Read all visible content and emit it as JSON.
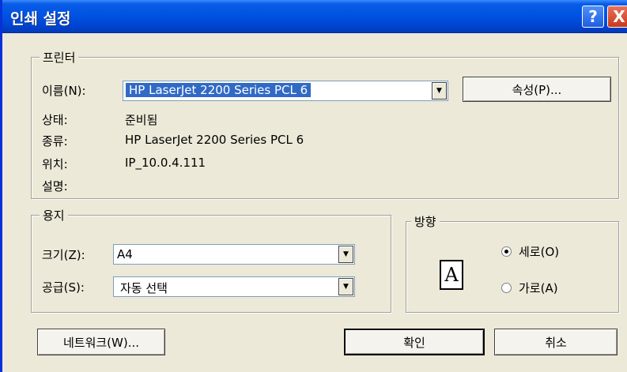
{
  "window": {
    "title": "인쇄 설정",
    "help_glyph": "?",
    "close_glyph": "X"
  },
  "printer": {
    "legend": "프린터",
    "name_label": "이름(N):",
    "name_value": "HP LaserJet 2200 Series PCL 6",
    "properties_button": "속성(P)...",
    "status_label": "상태:",
    "status_value": "준비됨",
    "type_label": "종류:",
    "type_value": "HP LaserJet 2200 Series PCL 6",
    "location_label": "위치:",
    "location_value": "IP_10.0.4.111",
    "comment_label": "설명:",
    "comment_value": ""
  },
  "paper": {
    "legend": "용지",
    "size_label": "크기(Z):",
    "size_value": "A4",
    "source_label": "공급(S):",
    "source_value": "자동 선택"
  },
  "orientation": {
    "legend": "방향",
    "icon_letter": "A",
    "portrait_label": "세로(O)",
    "landscape_label": "가로(A)",
    "selected": "portrait"
  },
  "buttons": {
    "network": "네트워크(W)...",
    "ok": "확인",
    "cancel": "취소"
  },
  "colors": {
    "titlebar": "#0054e3",
    "selection": "#316ac5",
    "dialog_bg": "#ece9d8"
  },
  "icons": {
    "dropdown": "chevron-down-icon",
    "orientation": "portrait-page-icon"
  }
}
